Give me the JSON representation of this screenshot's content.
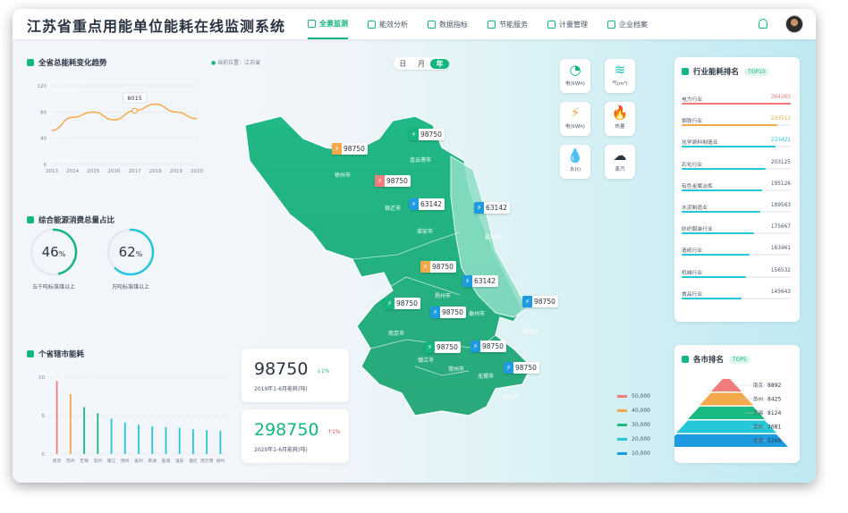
{
  "app": {
    "title": "江苏省重点用能单位能耗在线监测系统"
  },
  "nav": [
    {
      "label": "全景监测",
      "active": true
    },
    {
      "label": "能效分析",
      "active": false
    },
    {
      "label": "数据指标",
      "active": false
    },
    {
      "label": "节能服务",
      "active": false
    },
    {
      "label": "计量管理",
      "active": false
    },
    {
      "label": "企业档案",
      "active": false
    }
  ],
  "trend": {
    "title": "全省总能耗变化趋势",
    "callout": "8015",
    "chart_data": {
      "type": "line",
      "x": [
        "2013",
        "2014",
        "2015",
        "2016",
        "2017",
        "2018",
        "2019",
        "2020"
      ],
      "values": [
        52,
        72,
        80,
        68,
        82,
        92,
        80,
        70
      ],
      "ylim": [
        0,
        120
      ],
      "yticks": [
        "120",
        "80",
        "40",
        "0"
      ]
    }
  },
  "location": {
    "label": "当前位置：江苏省"
  },
  "toggle": {
    "day": "日",
    "month": "月",
    "year": "年"
  },
  "energy_ratio": {
    "title": "综合能源消费总量占比",
    "gauges": [
      {
        "value": "46",
        "unit": "%",
        "label": "五千吨标准煤以上"
      },
      {
        "value": "62",
        "unit": "%",
        "label": "万吨标准煤以上"
      }
    ]
  },
  "bars": {
    "title": "个省辖市能耗",
    "chart_data": {
      "type": "bar",
      "categories": [
        "南京",
        "苏州",
        "无锡",
        "常州",
        "镇江",
        "扬州",
        "泰州",
        "南通",
        "盐城",
        "淮安",
        "宿迁",
        "连云港",
        "徐州"
      ],
      "values": [
        9.5,
        7.8,
        6.1,
        5.3,
        4.6,
        4.1,
        3.8,
        3.6,
        3.5,
        3.4,
        3.2,
        3.1,
        3.0
      ],
      "colors": [
        "#f07c7c",
        "#f3a94a",
        "#18b982",
        "#18b982",
        "#24c7d8",
        "#24c7d8",
        "#24c7d8",
        "#24c7d8",
        "#24c7d8",
        "#24c7d8",
        "#24c7d8",
        "#24c7d8",
        "#24c7d8"
      ],
      "ylim": [
        0,
        10
      ],
      "yticks": [
        "10",
        "5",
        "0"
      ]
    }
  },
  "kpi": [
    {
      "value": "98750",
      "delta": "↓1%",
      "delta_color": "#14b57f",
      "label": "2019年1-6月能耗(吨)"
    },
    {
      "value": "298750",
      "delta": "↑1%",
      "delta_color": "#e04848",
      "label": "2020年1-6月能耗(吨)"
    }
  ],
  "map": {
    "labels": [
      {
        "value": "98750",
        "color": "#14b57f"
      },
      {
        "value": "98750",
        "color": "#f3a94a"
      },
      {
        "value": "98750",
        "color": "#f07c7c"
      },
      {
        "value": "63142",
        "color": "#1c9be0"
      },
      {
        "value": "63142",
        "color": "#1c9be0"
      },
      {
        "value": "98750",
        "color": "#f3a94a"
      },
      {
        "value": "63142",
        "color": "#1c9be0"
      },
      {
        "value": "98750",
        "color": "#14b57f"
      },
      {
        "value": "98750",
        "color": "#1c9be0"
      },
      {
        "value": "98750",
        "color": "#1c9be0"
      },
      {
        "value": "98750",
        "color": "#14b57f"
      },
      {
        "value": "98750",
        "color": "#1c9be0"
      },
      {
        "value": "98750",
        "color": "#1c9be0"
      }
    ],
    "cities": [
      "连云港市",
      "徐州市",
      "宿迁市",
      "淮安市",
      "盐城市",
      "扬州市",
      "泰州市",
      "南通市",
      "南京市",
      "镇江市",
      "常州市",
      "无锡市",
      "苏州市"
    ],
    "legend": [
      {
        "label": "50,000",
        "color": "#f07c7c"
      },
      {
        "label": "40,000",
        "color": "#f3a94a"
      },
      {
        "label": "30,000",
        "color": "#18b982"
      },
      {
        "label": "20,000",
        "color": "#24c7d8"
      },
      {
        "label": "10,000",
        "color": "#1c9be0"
      }
    ]
  },
  "weather": [
    {
      "glyph": "◔",
      "label": "电(kWh)",
      "color": "#14b57f"
    },
    {
      "glyph": "≋",
      "label": "气(m³)",
      "color": "#1bbfb0"
    },
    {
      "glyph": "⚡",
      "label": "电(kWh)",
      "color": "#f3a94a"
    },
    {
      "glyph": "🔥",
      "label": "热量",
      "color": "#f07c7c"
    },
    {
      "glyph": "💧",
      "label": "水(t)",
      "color": "#1c9be0"
    },
    {
      "glyph": "☁",
      "label": "蒸汽",
      "color": "#2a3442"
    }
  ],
  "ranking": {
    "title": "行业能耗排名",
    "tag": "TOP10",
    "rows": [
      {
        "name": "电力行业",
        "value": "264265",
        "color": "#f07c7c",
        "fill": 1.0
      },
      {
        "name": "钢铁行业",
        "value": "233512",
        "color": "#f3a94a",
        "fill": 0.88
      },
      {
        "name": "化学原料制造业",
        "value": "233421",
        "color": "#24c7d8",
        "fill": 0.86
      },
      {
        "name": "石化行业",
        "value": "203125",
        "color": "#24c7d8",
        "fill": 0.77
      },
      {
        "name": "有色金属冶炼",
        "value": "195126",
        "color": "#24c7d8",
        "fill": 0.74
      },
      {
        "name": "水泥制造业",
        "value": "189563",
        "color": "#24c7d8",
        "fill": 0.72
      },
      {
        "name": "纺织服装行业",
        "value": "175667",
        "color": "#24c7d8",
        "fill": 0.66
      },
      {
        "name": "造纸行业",
        "value": "163461",
        "color": "#24c7d8",
        "fill": 0.62
      },
      {
        "name": "机械行业",
        "value": "156532",
        "color": "#24c7d8",
        "fill": 0.59
      },
      {
        "name": "食品行业",
        "value": "145643",
        "color": "#24c7d8",
        "fill": 0.55
      }
    ]
  },
  "top5": {
    "title": "各市排名",
    "tag": "TOP5",
    "rows": [
      {
        "name": "南京",
        "value": "8892",
        "color": "#f07c7c"
      },
      {
        "name": "苏州",
        "value": "8425",
        "color": "#f3a94a"
      },
      {
        "name": "无锡",
        "value": "8124",
        "color": "#18b982"
      },
      {
        "name": "常州",
        "value": "7681",
        "color": "#24c7d8"
      },
      {
        "name": "南通",
        "value": "5266",
        "color": "#1c9be0"
      }
    ]
  }
}
